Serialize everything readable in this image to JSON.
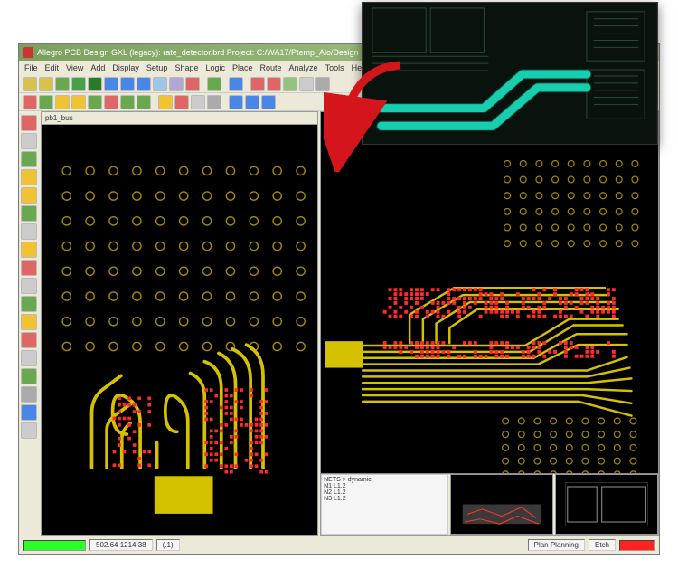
{
  "titlebar": {
    "title": "Allegro PCB Design GXL (legacy): rate_detector.brd  Project: C:/WA17/Ptemp_Alo/Design"
  },
  "menubar": {
    "items": [
      "File",
      "Edit",
      "View",
      "Add",
      "Display",
      "Setup",
      "Shape",
      "Logic",
      "Place",
      "Route",
      "Analyze",
      "Tools",
      "Help"
    ]
  },
  "toolbar_colors": {
    "row1": [
      "#d9c24a",
      "#d9c24a",
      "#6aa84f",
      "#46a046",
      "#2a7a2a",
      "#4a86e8",
      "#4a86e8",
      "#4a86e8",
      "#9fc5e8",
      "#b4a7d6",
      "#e06666",
      "",
      "#6aa84f",
      "",
      "#4a86e8",
      "",
      "#e06666",
      "#e06666",
      "#93c47d",
      "#cccccc",
      "#aaaaaa"
    ],
    "row2": [
      "#e06666",
      "#6aa84f",
      "#f1c232",
      "#f1c232",
      "#6aa84f",
      "#e06666",
      "#6aa84f",
      "#6aa84f",
      "",
      "#f1c232",
      "#e06666",
      "#cccccc",
      "#aaaaaa",
      "",
      "#4a86e8",
      "#4a86e8",
      "#4a86e8"
    ]
  },
  "vtool_colors": [
    "#e06666",
    "#cccccc",
    "#6aa84f",
    "#f1c232",
    "#f1c232",
    "#6aa84f",
    "#cccccc",
    "#f1c232",
    "#e06666",
    "#cccccc",
    "#6aa84f",
    "#f1c232",
    "#e06666",
    "#cccccc",
    "#6aa84f",
    "#aaaaaa",
    "#4a86e8",
    "#cccccc"
  ],
  "tabs": {
    "left": "pb1_bus"
  },
  "statusbar": {
    "coords": "502.64  1214.38",
    "units": "(.1)",
    "mode": "Plan Planning",
    "etch": "Etch"
  },
  "bottom_panel": {
    "text_label": "NETS > dynamic",
    "text_lines": [
      "N1   L1.2",
      "N2   L1.2",
      "N3   L1.2"
    ]
  },
  "icon_glyphs": {
    "close": "×",
    "minimize": "–",
    "maximize": "❐"
  }
}
